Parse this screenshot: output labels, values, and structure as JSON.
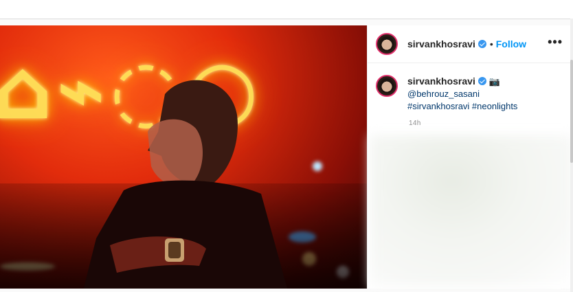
{
  "post": {
    "username": "sirvankhosravi",
    "follow_label": "Follow",
    "separator": "•",
    "more_label": "•••",
    "caption": {
      "username": "sirvankhosravi",
      "camera_emoji": "📷",
      "mention": "@behrouz_sasani",
      "hashtags": "#sirvankhosravi #neonlights"
    },
    "time": "14h"
  },
  "colors": {
    "accent": "#0095f6",
    "verified": "#3897f0",
    "link": "#00376b"
  }
}
